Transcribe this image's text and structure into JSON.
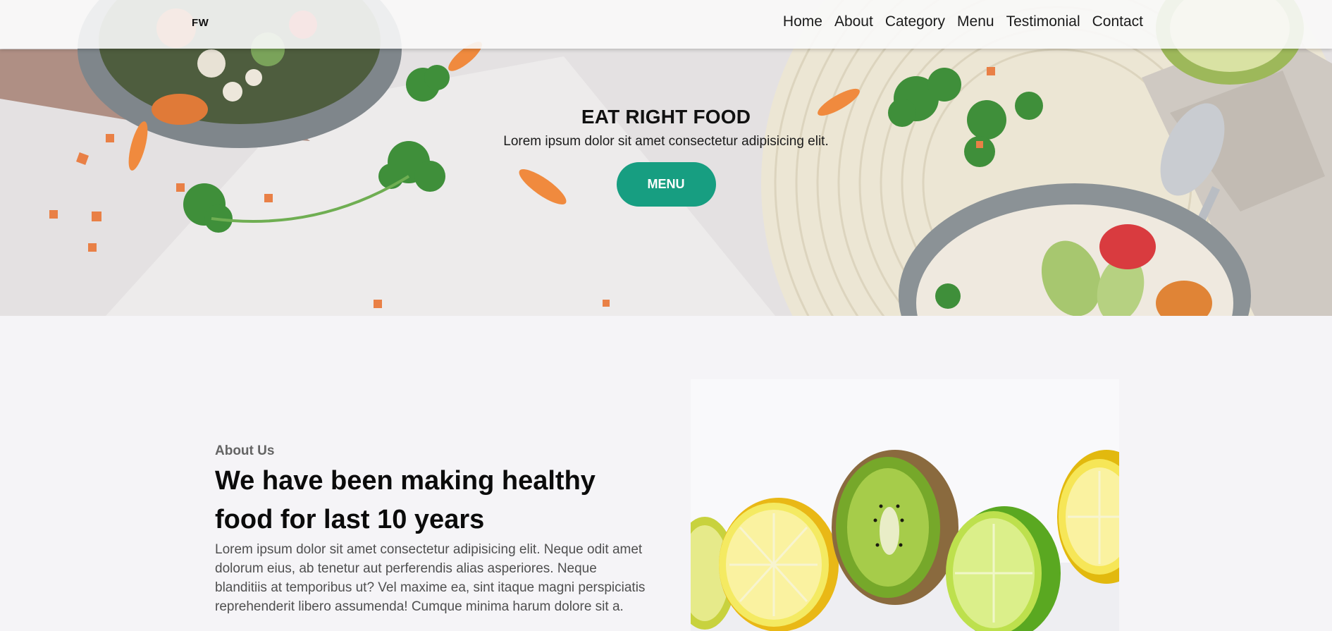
{
  "navbar": {
    "logo": "FW",
    "links": [
      "Home",
      "About",
      "Category",
      "Menu",
      "Testimonial",
      "Contact"
    ]
  },
  "hero": {
    "title": "EAT RIGHT FOOD",
    "subtitle": "Lorem ipsum dolor sit amet consectetur adipisicing elit.",
    "button_label": "MENU"
  },
  "about": {
    "label": "About Us",
    "title": "We have been making healthy food for last 10 years",
    "text": "Lorem ipsum dolor sit amet consectetur adipisicing elit. Neque odit amet dolorum eius, ab tenetur aut perferendis alias asperiores. Neque blanditiis at temporibus ut? Vel maxime ea, sint itaque magni perspiciatis reprehenderit libero assumenda! Cumque minima harum dolore sit a."
  },
  "colors": {
    "accent": "#179e81",
    "page_background": "#f5f4f7",
    "navbar_background": "#faf9fa"
  },
  "images": {
    "hero_background": "food-bowls-photo",
    "about_image": "citrus-kiwi-photo"
  }
}
